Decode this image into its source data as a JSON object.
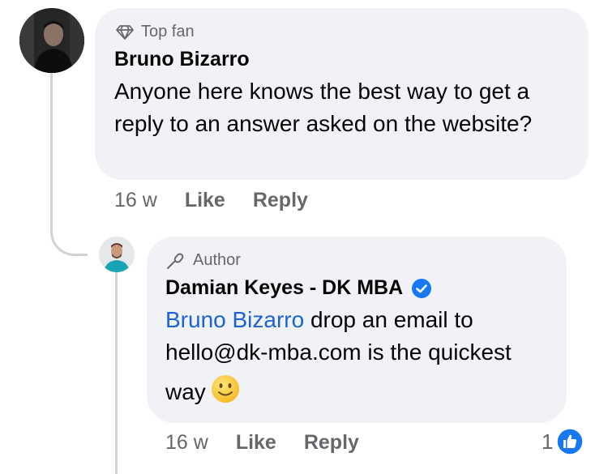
{
  "comment": {
    "badge": "Top fan",
    "author": "Bruno Bizarro",
    "text": "Anyone here knows the best way to get a reply to an answer asked on the website?",
    "time": "16 w",
    "like_label": "Like",
    "reply_label": "Reply"
  },
  "reply": {
    "badge": "Author",
    "author": "Damian Keyes - DK MBA",
    "mention": "Bruno Bizarro",
    "text_line1": " drop an email to",
    "text_line2": "hello@dk-mba.com is the quickest",
    "text_line3": "way",
    "emoji": "slightly-smiling-face",
    "time": "16 w",
    "like_label": "Like",
    "reply_label": "Reply",
    "reaction_count": "1",
    "reaction_icon": "thumbs-up-icon"
  },
  "colors": {
    "bubble": "#f0f2f5",
    "mention": "#1b64d6",
    "verified": "#1877f2",
    "secondary_text": "#65676b"
  }
}
